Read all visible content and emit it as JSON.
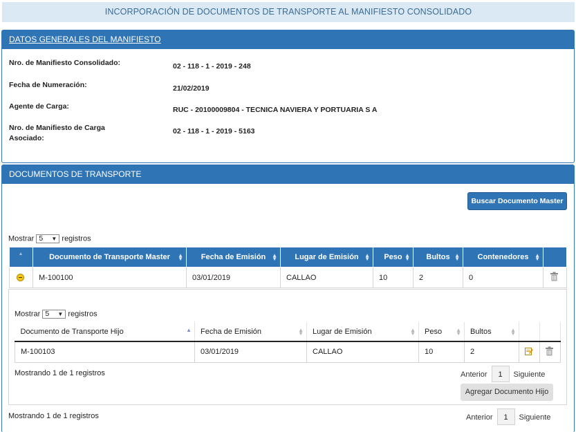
{
  "page_title": "INCORPORACIÓN DE DOCUMENTOS DE TRANSPORTE AL MANIFIESTO CONSOLIDADO",
  "general": {
    "title": "DATOS GENERALES DEL MANIFIESTO",
    "fields": [
      {
        "label": "Nro. de Manifiesto Consolidado:",
        "value": "02 - 118 - 1 - 2019 - 248"
      },
      {
        "label": "Fecha de Numeración:",
        "value": "21/02/2019"
      },
      {
        "label": "Agente de Carga:",
        "value": "RUC - 20100009804 - TECNICA NAVIERA Y PORTUARIA S A"
      },
      {
        "label": "Nro. de Manifiesto de Carga Asociado:",
        "value": "02 - 118 - 1 - 2019 - 5163"
      }
    ]
  },
  "documents": {
    "title": "DOCUMENTOS DE TRANSPORTE",
    "search_button": "Buscar Documento Master",
    "show_label": "Mostrar",
    "show_value": "5",
    "records_label": "registros",
    "master_columns": [
      "Documento de Transporte Master",
      "Fecha de Emisión",
      "Lugar de Emisión",
      "Peso",
      "Bultos",
      "Contenedores"
    ],
    "master_rows": [
      {
        "doc": "M-100100",
        "fecha": "03/01/2019",
        "lugar": "CALLAO",
        "peso": "10",
        "bultos": "2",
        "contenedores": "0"
      }
    ],
    "child": {
      "show_label": "Mostrar",
      "show_value": "5",
      "records_label": "registros",
      "columns": [
        "Documento de Transporte Hijo",
        "Fecha de Emisión",
        "Lugar de Emisión",
        "Peso",
        "Bultos"
      ],
      "rows": [
        {
          "doc": "M-100103",
          "fecha": "03/01/2019",
          "lugar": "CALLAO",
          "peso": "10",
          "bultos": "2"
        }
      ],
      "summary": "Mostrando 1 de 1 registros",
      "prev": "Anterior",
      "page": "1",
      "next": "Siguiente",
      "add_button": "Agregar Documento Hijo"
    },
    "summary": "Mostrando 1 de 1 registros",
    "prev": "Anterior",
    "page": "1",
    "next": "Siguiente"
  },
  "colors": {
    "accent": "#2f74b5",
    "banner": "#dbe9f4"
  }
}
